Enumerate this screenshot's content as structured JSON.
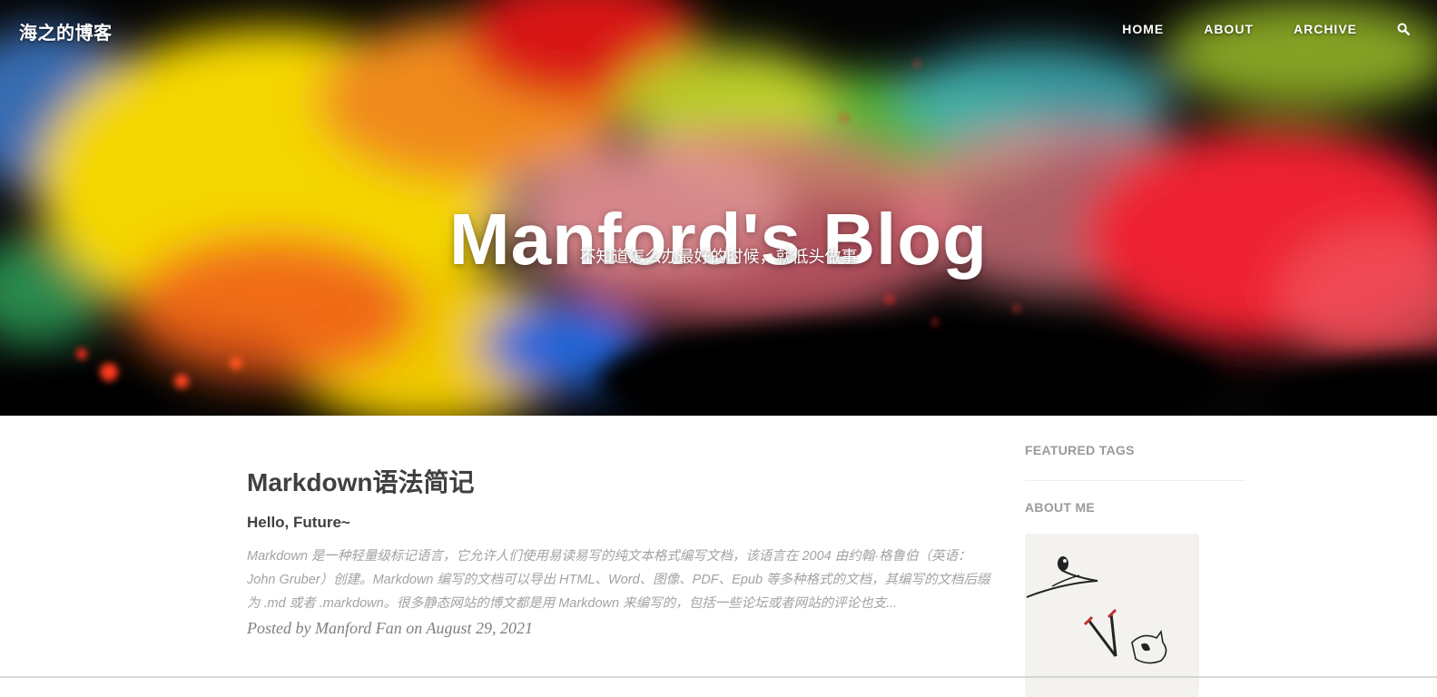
{
  "brand": "海之的博客",
  "nav": {
    "home": "HOME",
    "about": "ABOUT",
    "archive": "ARCHIVE",
    "search_icon": "search-icon"
  },
  "hero": {
    "title": "Manford's Blog",
    "subtitle": "不知道怎么办最好的时候，就低头做事"
  },
  "post": {
    "title": "Markdown语法简记",
    "subtitle": "Hello, Future~",
    "excerpt": "Markdown 是一种轻量级标记语言，它允许人们使用易读易写的纯文本格式编写文档，该语言在 2004 由约翰·格鲁伯（英语：John Gruber）创建。Markdown 编写的文档可以导出 HTML、Word、图像、PDF、Epub 等多种格式的文档，其编写的文档后缀为 .md 或者 .markdown。很多静态网站的博文都是用 Markdown 来编写的，包括一些论坛或者网站的评论也支...",
    "meta": "Posted by Manford Fan on August 29, 2021"
  },
  "sidebar": {
    "featured_tags": "FEATURED TAGS",
    "about_me": "ABOUT ME",
    "avatar_icon": "avatar-illustration"
  },
  "colors": {
    "text_dark": "#404040",
    "text_muted": "#a3a3a3",
    "sidebar_heading": "#9a9a9a"
  }
}
